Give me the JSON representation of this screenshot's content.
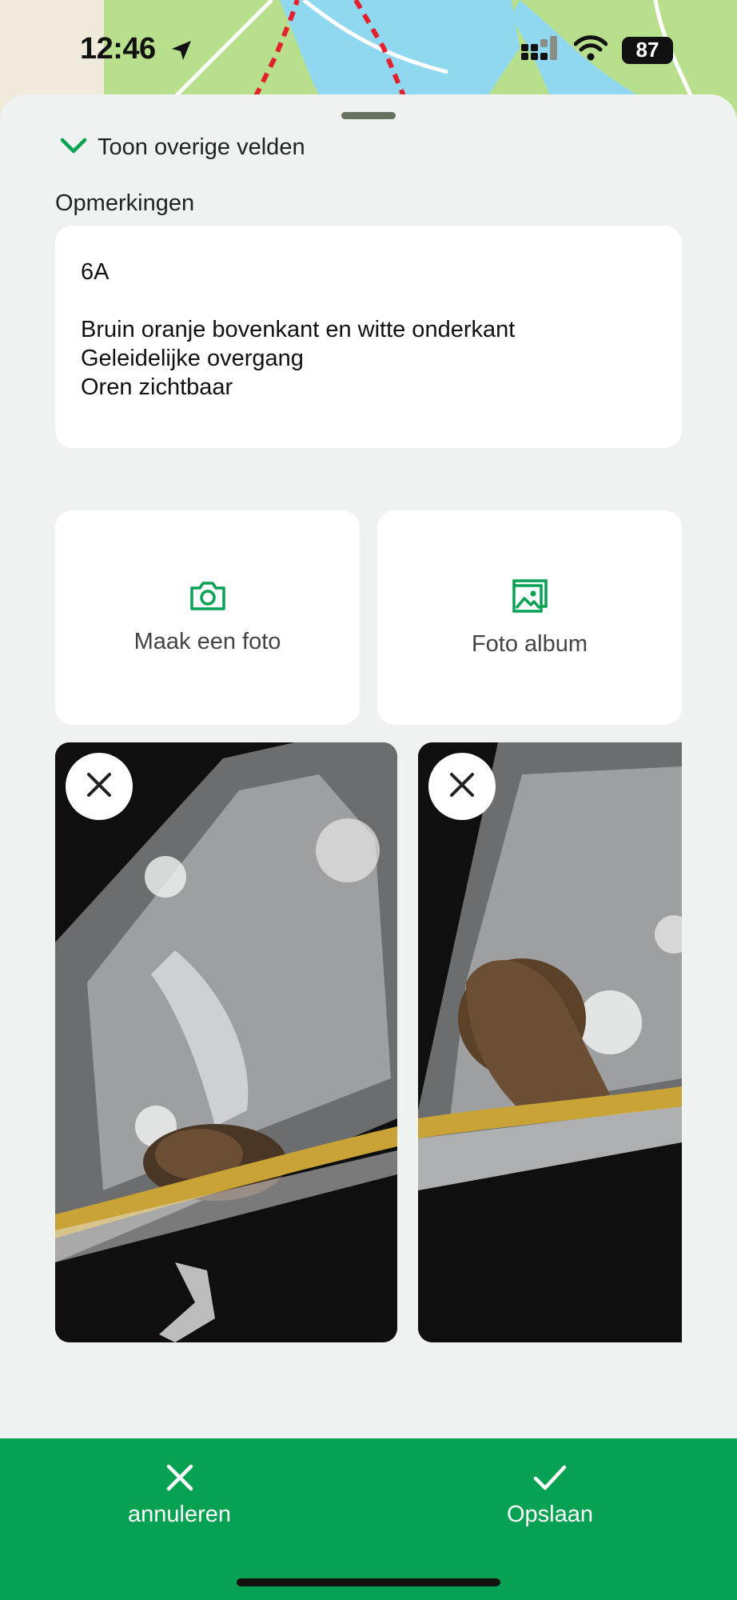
{
  "status_bar": {
    "time": "12:46",
    "battery": "87",
    "icons": [
      "location-arrow-icon",
      "cellular-signal-icon",
      "wifi-icon",
      "battery-icon"
    ]
  },
  "form": {
    "toggle_fields_label": "Toon overige velden",
    "notes_label": "Opmerkingen",
    "notes_lines": [
      "6A",
      "",
      "Bruin oranje bovenkant en witte onderkant",
      "Geleidelijke overgang",
      "Oren zichtbaar"
    ]
  },
  "photo_actions": {
    "camera_label": "Maak een foto",
    "album_label": "Foto album"
  },
  "photos": [
    {
      "description_icon": "photo-thumbnail"
    },
    {
      "description_icon": "photo-thumbnail"
    }
  ],
  "bottom_bar": {
    "cancel_label": "annuleren",
    "save_label": "Opslaan"
  },
  "colors": {
    "accent_green": "#07a152",
    "sheet_background": "#eef2f0",
    "card_background": "#ffffff",
    "map_land": "#b8df8c",
    "map_water": "#8fd8ef",
    "trail_red": "#e3202b"
  }
}
